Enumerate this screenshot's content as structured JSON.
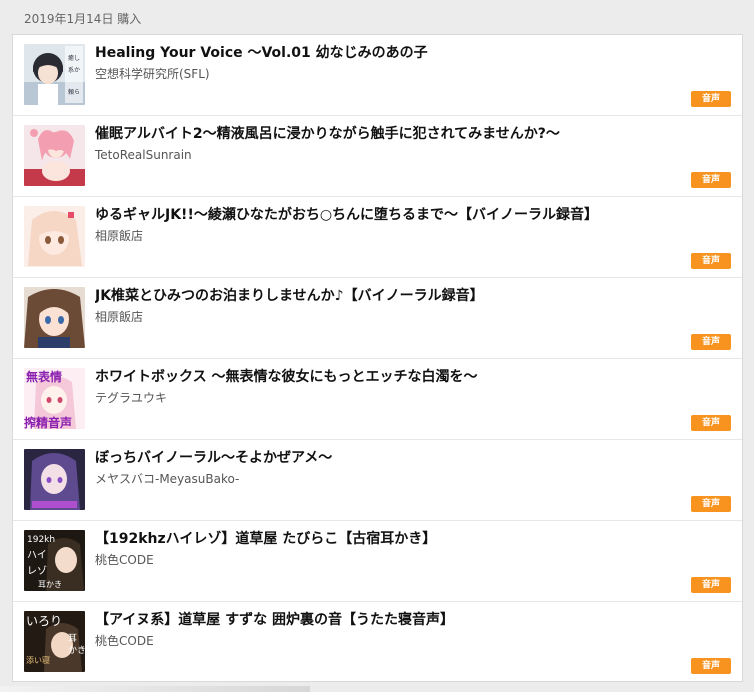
{
  "purchase_date": "2019年1月14日 購入",
  "badge_color": "#f7931e",
  "items": [
    {
      "title": "Healing Your Voice 〜Vol.01 幼なじみのあの子",
      "circle": "空想科学研究所(SFL)",
      "badge": "音声",
      "thumb_text": "癒し系から 頼られ"
    },
    {
      "title": "催眠アルバイト2〜精液風呂に浸かりながら触手に犯されてみませんか?〜",
      "circle": "TetoRealSunrain",
      "badge": "音声",
      "thumb_text": ""
    },
    {
      "title": "ゆるギャルJK!!〜綾瀬ひなたがおち○ちんに堕ちるまで〜【バイノーラル録音】",
      "circle": "相原飯店",
      "badge": "音声",
      "thumb_text": ""
    },
    {
      "title": "JK椎菜とひみつのお泊まりしませんか♪【バイノーラル録音】",
      "circle": "相原飯店",
      "badge": "音声",
      "thumb_text": ""
    },
    {
      "title": "ホワイトボックス 〜無表情な彼女にもっとエッチな白濁を〜",
      "circle": "テグラユウキ",
      "badge": "音声",
      "thumb_text": "無表情 搾精音声"
    },
    {
      "title": "ぼっちバイノーラル〜そよかぜアメ〜",
      "circle": "メヤスバコ-MeyasuBako-",
      "badge": "音声",
      "thumb_text": ""
    },
    {
      "title": "【192khzハイレゾ】道草屋 たびらこ【古宿耳かき】",
      "circle": "桃色CODE",
      "badge": "音声",
      "thumb_text": "192kh ハイレ 古宿 耳かき"
    },
    {
      "title": "【アイヌ系】道草屋 すずな 囲炉裏の音【うたた寝音声】",
      "circle": "桃色CODE",
      "badge": "音声",
      "thumb_text": "いろり 耳かき 添い寝"
    }
  ]
}
